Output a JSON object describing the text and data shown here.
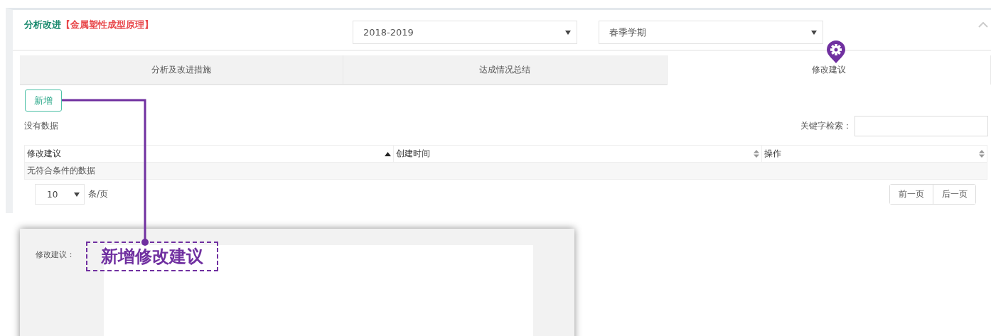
{
  "panel": {
    "title": "分析改进",
    "course": "【金属塑性成型原理】",
    "year_select": {
      "value": "2018-2019"
    },
    "term_select": {
      "value": "春季学期"
    }
  },
  "tabs": [
    {
      "label": "分析及改进措施",
      "selected": false
    },
    {
      "label": "达成情况总结",
      "selected": false
    },
    {
      "label": "修改建议",
      "selected": true
    }
  ],
  "add_button": "新增",
  "status_text": "没有数据",
  "search": {
    "label": "关键字检索："
  },
  "table": {
    "columns": [
      {
        "label": "修改建议",
        "sorted": true
      },
      {
        "label": "创建时间",
        "sorted": false
      },
      {
        "label": "操作",
        "sorted": false
      }
    ],
    "empty_text": "无符合条件的数据"
  },
  "page_size": {
    "value": "10",
    "suffix": "条/页"
  },
  "pager": [
    "前一页",
    "后一页"
  ],
  "dialog": {
    "field_label": "修改建议："
  },
  "annotation": {
    "text": "新增修改建议"
  }
}
